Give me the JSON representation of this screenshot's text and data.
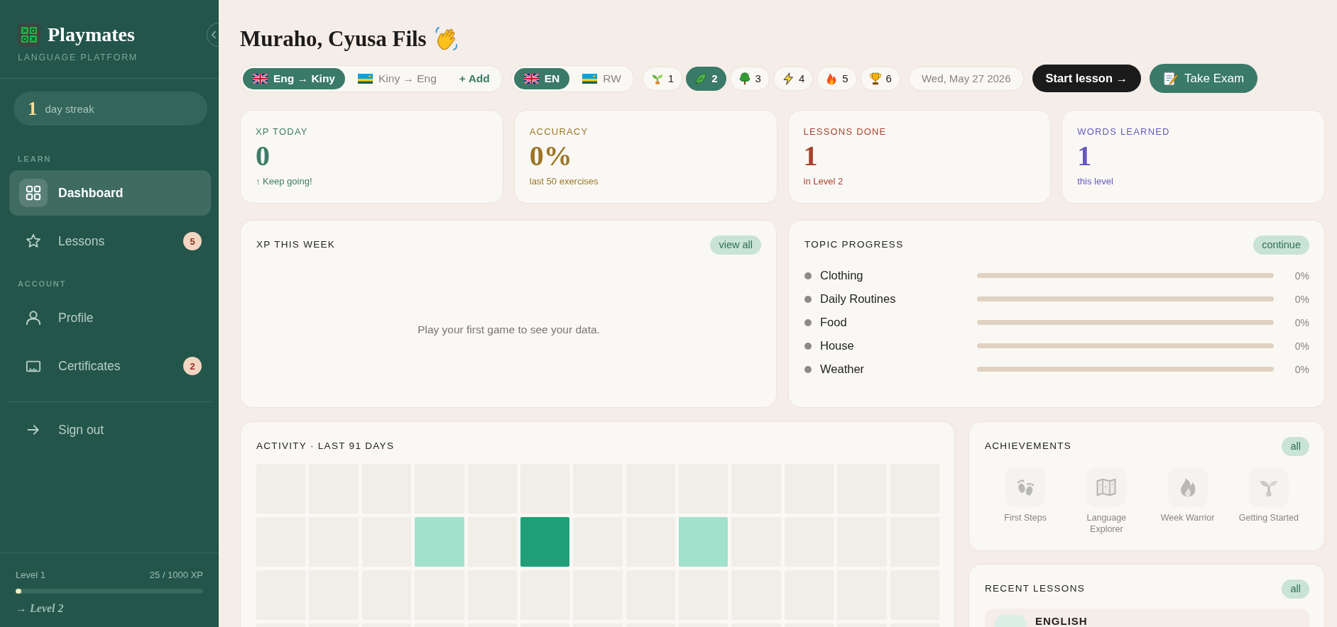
{
  "sidebar": {
    "brand": {
      "name": "Playmates",
      "tagline": "LANGUAGE PLATFORM"
    },
    "streak": {
      "count": "1",
      "label": "day streak"
    },
    "sections": [
      {
        "title": "LEARN",
        "items": [
          {
            "label": "Dashboard",
            "selected": true
          },
          {
            "label": "Lessons",
            "badge": "5",
            "selected": false
          }
        ]
      },
      {
        "title": "ACCOUNT",
        "items": [
          {
            "label": "Profile",
            "selected": false
          },
          {
            "label": "Certificates",
            "badge": "2",
            "selected": false
          }
        ]
      }
    ],
    "sign_out": "Sign out",
    "progress": {
      "label": "Level 1",
      "reading": "25 / 1000 XP",
      "level": 0.025,
      "next": "→ Level 2"
    }
  },
  "header": {
    "greeting": "Muraho, Cyusa Fils",
    "directions": [
      {
        "label": "Eng → Kiny",
        "selected": true
      },
      {
        "label": "Kiny → Eng",
        "selected": false
      }
    ],
    "add_button": "+ Add",
    "languages": [
      {
        "label": "EN",
        "selected": true
      },
      {
        "label": "RW",
        "selected": false
      }
    ],
    "levels": [
      {
        "label": "1",
        "selected": false
      },
      {
        "label": "2",
        "selected": true
      },
      {
        "label": "3",
        "selected": false
      },
      {
        "label": "4",
        "selected": false
      },
      {
        "label": "5",
        "selected": false
      },
      {
        "label": "6",
        "selected": false
      }
    ],
    "date": "Wed, May 27 2026",
    "start_button": "Start lesson →",
    "exam_button": "Take Exam"
  },
  "stats": [
    {
      "label": "XP TODAY",
      "value": "0",
      "note": "↑ Keep going!",
      "color": "#3d7c69"
    },
    {
      "label": "ACCURACY",
      "value": "0%",
      "note": "last 50 exercises",
      "color": "#9c7626"
    },
    {
      "label": "LESSONS DONE",
      "value": "1",
      "note": "in Level 2",
      "color": "#a6432c"
    },
    {
      "label": "WORDS LEARNED",
      "value": "1",
      "note": "this level",
      "color": "#6657bd"
    }
  ],
  "xp_week": {
    "title": "XP THIS WEEK",
    "action": "view all",
    "empty_message": "Play your first game to see your data."
  },
  "topic_progress": {
    "title": "TOPIC PROGRESS",
    "action": "continue",
    "items": [
      {
        "name": "Clothing",
        "level": 0,
        "reading": "0%"
      },
      {
        "name": "Daily Routines",
        "level": 0,
        "reading": "0%"
      },
      {
        "name": "Food",
        "level": 0,
        "reading": "0%"
      },
      {
        "name": "House",
        "level": 0,
        "reading": "0%"
      },
      {
        "name": "Weather",
        "level": 0,
        "reading": "0%"
      }
    ]
  },
  "activity": {
    "title": "ACTIVITY · LAST 91 DAYS",
    "rows": [
      {
        "cells": [
          {
            "color": "#f1ede7"
          },
          {
            "color": "#f1ede7"
          },
          {
            "color": "#f1ede7"
          },
          {
            "color": "#f1ede7"
          },
          {
            "color": "#f1ede7"
          },
          {
            "color": "#f1ede7"
          },
          {
            "color": "#f1ede7"
          },
          {
            "color": "#f1ede7"
          },
          {
            "color": "#f1ede7"
          },
          {
            "color": "#f1ede7"
          },
          {
            "color": "#f1ede7"
          },
          {
            "color": "#f1ede7"
          },
          {
            "color": "#f1ede7"
          }
        ]
      },
      {
        "cells": [
          {
            "color": "#f1ede7"
          },
          {
            "color": "#f1ede7"
          },
          {
            "color": "#f1ede7"
          },
          {
            "color": "#a2e1cb"
          },
          {
            "color": "#f1ede7"
          },
          {
            "color": "#1f9f78"
          },
          {
            "color": "#f1ede7"
          },
          {
            "color": "#f1ede7"
          },
          {
            "color": "#a2e1cb"
          },
          {
            "color": "#f1ede7"
          },
          {
            "color": "#f1ede7"
          },
          {
            "color": "#f1ede7"
          },
          {
            "color": "#f1ede7"
          }
        ]
      },
      {
        "cells": [
          {
            "color": "#f1ede7"
          },
          {
            "color": "#f1ede7"
          },
          {
            "color": "#f1ede7"
          },
          {
            "color": "#f1ede7"
          },
          {
            "color": "#f1ede7"
          },
          {
            "color": "#f1ede7"
          },
          {
            "color": "#f1ede7"
          },
          {
            "color": "#f1ede7"
          },
          {
            "color": "#f1ede7"
          },
          {
            "color": "#f1ede7"
          },
          {
            "color": "#f1ede7"
          },
          {
            "color": "#f1ede7"
          },
          {
            "color": "#f1ede7"
          }
        ]
      },
      {
        "cells": [
          {
            "color": "#f1ede7"
          },
          {
            "color": "#f1ede7"
          },
          {
            "color": "#f1ede7"
          },
          {
            "color": "#f1ede7"
          },
          {
            "color": "#f1ede7"
          },
          {
            "color": "#f1ede7"
          },
          {
            "color": "#f1ede7"
          },
          {
            "color": "#f1ede7"
          },
          {
            "color": "#f1ede7"
          },
          {
            "color": "#f1ede7"
          },
          {
            "color": "#f1ede7"
          },
          {
            "color": "#f1ede7"
          },
          {
            "color": "#f1ede7"
          }
        ]
      }
    ]
  },
  "achievements": {
    "title": "ACHIEVEMENTS",
    "action": "all",
    "items": [
      {
        "name": "First Steps",
        "locked": true
      },
      {
        "name": "Language Explorer",
        "locked": true
      },
      {
        "name": "Week Warrior",
        "locked": true
      },
      {
        "name": "Getting Started",
        "locked": true
      }
    ]
  },
  "recent_lessons": {
    "title": "RECENT LESSONS",
    "action": "all",
    "items": [
      {
        "title": "ENGLISH"
      }
    ]
  }
}
